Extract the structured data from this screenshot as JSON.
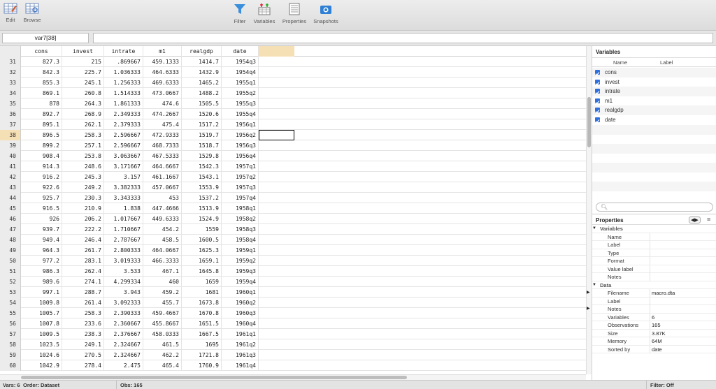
{
  "toolbar": {
    "left": [
      {
        "label": "Edit",
        "icon": "edit-grid-icon"
      },
      {
        "label": "Browse",
        "icon": "browse-grid-icon"
      }
    ],
    "center": [
      {
        "label": "Filter",
        "icon": "filter-icon"
      },
      {
        "label": "Variables",
        "icon": "variables-icon"
      },
      {
        "label": "Properties",
        "icon": "properties-icon"
      },
      {
        "label": "Snapshots",
        "icon": "camera-icon"
      }
    ]
  },
  "cell": {
    "name": "var7[38]",
    "value": ""
  },
  "columns": [
    "cons",
    "invest",
    "intrate",
    "m1",
    "realgdp",
    "date"
  ],
  "rows": [
    [
      "31",
      "827.3",
      "215",
      ".869667",
      "459.1333",
      "1414.7",
      "1954q3"
    ],
    [
      "32",
      "842.3",
      "225.7",
      "1.036333",
      "464.6333",
      "1432.9",
      "1954q4"
    ],
    [
      "33",
      "855.3",
      "245.1",
      "1.256333",
      "469.6333",
      "1465.2",
      "1955q1"
    ],
    [
      "34",
      "869.1",
      "260.8",
      "1.514333",
      "473.0667",
      "1488.2",
      "1955q2"
    ],
    [
      "35",
      "878",
      "264.3",
      "1.861333",
      "474.6",
      "1505.5",
      "1955q3"
    ],
    [
      "36",
      "892.7",
      "268.9",
      "2.349333",
      "474.2667",
      "1520.6",
      "1955q4"
    ],
    [
      "37",
      "895.1",
      "262.1",
      "2.379333",
      "475.4",
      "1517.2",
      "1956q1"
    ],
    [
      "38",
      "896.5",
      "258.3",
      "2.596667",
      "472.9333",
      "1519.7",
      "1956q2"
    ],
    [
      "39",
      "899.2",
      "257.1",
      "2.596667",
      "468.7333",
      "1518.7",
      "1956q3"
    ],
    [
      "40",
      "908.4",
      "253.8",
      "3.063667",
      "467.5333",
      "1529.8",
      "1956q4"
    ],
    [
      "41",
      "914.3",
      "248.6",
      "3.171667",
      "464.6667",
      "1542.3",
      "1957q1"
    ],
    [
      "42",
      "916.2",
      "245.3",
      "3.157",
      "461.1667",
      "1543.1",
      "1957q2"
    ],
    [
      "43",
      "922.6",
      "249.2",
      "3.382333",
      "457.0667",
      "1553.9",
      "1957q3"
    ],
    [
      "44",
      "925.7",
      "230.3",
      "3.343333",
      "453",
      "1537.2",
      "1957q4"
    ],
    [
      "45",
      "916.5",
      "210.9",
      "1.838",
      "447.4666",
      "1513.9",
      "1958q1"
    ],
    [
      "46",
      "926",
      "206.2",
      "1.017667",
      "449.6333",
      "1524.9",
      "1958q2"
    ],
    [
      "47",
      "939.7",
      "222.2",
      "1.710667",
      "454.2",
      "1559",
      "1958q3"
    ],
    [
      "48",
      "949.4",
      "246.4",
      "2.787667",
      "458.5",
      "1600.5",
      "1958q4"
    ],
    [
      "49",
      "964.3",
      "261.7",
      "2.800333",
      "464.0667",
      "1625.3",
      "1959q1"
    ],
    [
      "50",
      "977.2",
      "283.1",
      "3.019333",
      "466.3333",
      "1659.1",
      "1959q2"
    ],
    [
      "51",
      "986.3",
      "262.4",
      "3.533",
      "467.1",
      "1645.8",
      "1959q3"
    ],
    [
      "52",
      "989.6",
      "274.1",
      "4.299334",
      "460",
      "1659",
      "1959q4"
    ],
    [
      "53",
      "997.1",
      "288.7",
      "3.943",
      "459.2",
      "1681",
      "1960q1"
    ],
    [
      "54",
      "1009.8",
      "261.4",
      "3.092333",
      "455.7",
      "1673.8",
      "1960q2"
    ],
    [
      "55",
      "1005.7",
      "258.3",
      "2.390333",
      "459.4667",
      "1670.8",
      "1960q3"
    ],
    [
      "56",
      "1007.8",
      "233.6",
      "2.360667",
      "455.8667",
      "1651.5",
      "1960q4"
    ],
    [
      "57",
      "1009.5",
      "238.3",
      "2.376667",
      "458.0333",
      "1667.5",
      "1961q1"
    ],
    [
      "58",
      "1023.5",
      "249.1",
      "2.324667",
      "461.5",
      "1695",
      "1961q2"
    ],
    [
      "59",
      "1024.6",
      "270.5",
      "2.324667",
      "462.2",
      "1721.8",
      "1961q3"
    ],
    [
      "60",
      "1042.9",
      "278.4",
      "2.475",
      "465.4",
      "1760.9",
      "1961q4"
    ]
  ],
  "selected_row": "38",
  "variables_panel": {
    "title": "Variables",
    "name_header": "Name",
    "label_header": "Label",
    "items": [
      "cons",
      "invest",
      "intrate",
      "m1",
      "realgdp",
      "date"
    ],
    "search_placeholder": ""
  },
  "properties_panel": {
    "title": "Properties",
    "var_section": "Variables",
    "var_fields": [
      "Name",
      "Label",
      "Type",
      "Format",
      "Value label",
      "Notes"
    ],
    "data_section": "Data",
    "data_fields": [
      {
        "k": "Filename",
        "v": "macro.dta",
        "arrow": true
      },
      {
        "k": "Label",
        "v": ""
      },
      {
        "k": "Notes",
        "v": "",
        "arrow": true
      },
      {
        "k": "Variables",
        "v": "6"
      },
      {
        "k": "Observations",
        "v": "165"
      },
      {
        "k": "Size",
        "v": "3.87K"
      },
      {
        "k": "Memory",
        "v": "64M"
      },
      {
        "k": "Sorted by",
        "v": "date"
      }
    ]
  },
  "status": {
    "vars": "Vars: 6",
    "order": "Order: Dataset",
    "obs": "Obs: 165",
    "filter": "Filter: Off"
  }
}
